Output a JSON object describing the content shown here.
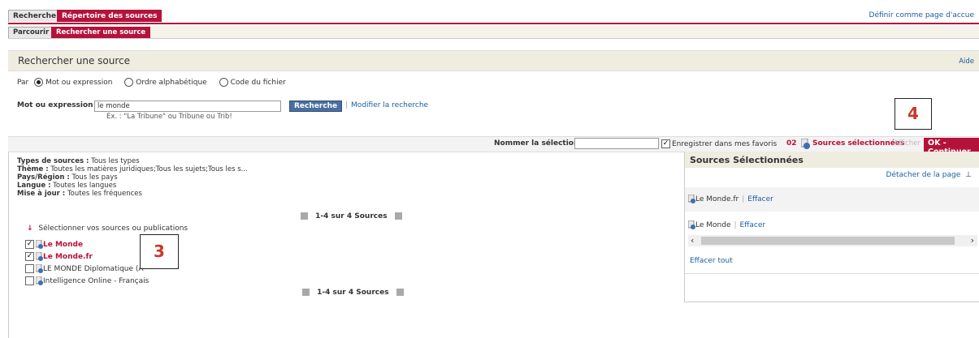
{
  "tabs": {
    "recherche": "Recherche",
    "repertoire": "Répertoire des sources"
  },
  "subtabs": {
    "parcourir": "Parcourir",
    "rechercher": "Rechercher une source"
  },
  "header_link": "Définir comme page d'accue",
  "panel": {
    "title": "Rechercher une source",
    "aide": "Aide"
  },
  "search": {
    "par_label": "Par",
    "options": [
      "Mot ou expression",
      "Ordre alphabétique",
      "Code du fichier"
    ],
    "selected": "Mot ou expression",
    "field_label": "Mot ou expression",
    "value": "le monde",
    "example": "Ex. : \"La Tribune\" ou Tribune ou Trib!",
    "button": "Recherche",
    "modify": "Modifier la recherche"
  },
  "selection": {
    "name_label": "Nommer la sélection",
    "favorites_label": "Enregistrer dans mes favoris",
    "favorites_checked": true,
    "count": "02",
    "sources_label": "Sources sélectionnées",
    "afficher": "Afficher",
    "ok_button": "OK - Continuer"
  },
  "filters": [
    {
      "label": "Types de sources :",
      "value": "Tous les types"
    },
    {
      "label": "Thème :",
      "value": "Toutes les matières juridiques;Tous les sujets;Tous les s..."
    },
    {
      "label": "Pays/Région :",
      "value": "Tous les pays"
    },
    {
      "label": "Langue :",
      "value": "Toutes les langues"
    },
    {
      "label": "Mise à jour :",
      "value": "Toutes les fréquences"
    }
  ],
  "pagination": "1-4 sur 4 Sources",
  "select_sources_label": "Sélectionner vos sources ou publications",
  "sources": [
    {
      "name": "Le Monde",
      "checked": true,
      "highlight": true
    },
    {
      "name": "Le Monde.fr",
      "checked": true,
      "highlight": true
    },
    {
      "name": "LE MONDE Diplomatique (A",
      "checked": false,
      "highlight": false
    },
    {
      "name": "Intelligence Online - Français",
      "checked": false,
      "highlight": false
    }
  ],
  "annotations": {
    "three": "3",
    "four": "4"
  },
  "selected_panel": {
    "title": "Sources Sélectionnées",
    "detach": "Détacher de la page",
    "items": [
      {
        "name": "Le Monde.fr",
        "action": "Effacer"
      },
      {
        "name": "Le Monde",
        "action": "Effacer"
      }
    ],
    "clear_all": "Effacer tout"
  }
}
